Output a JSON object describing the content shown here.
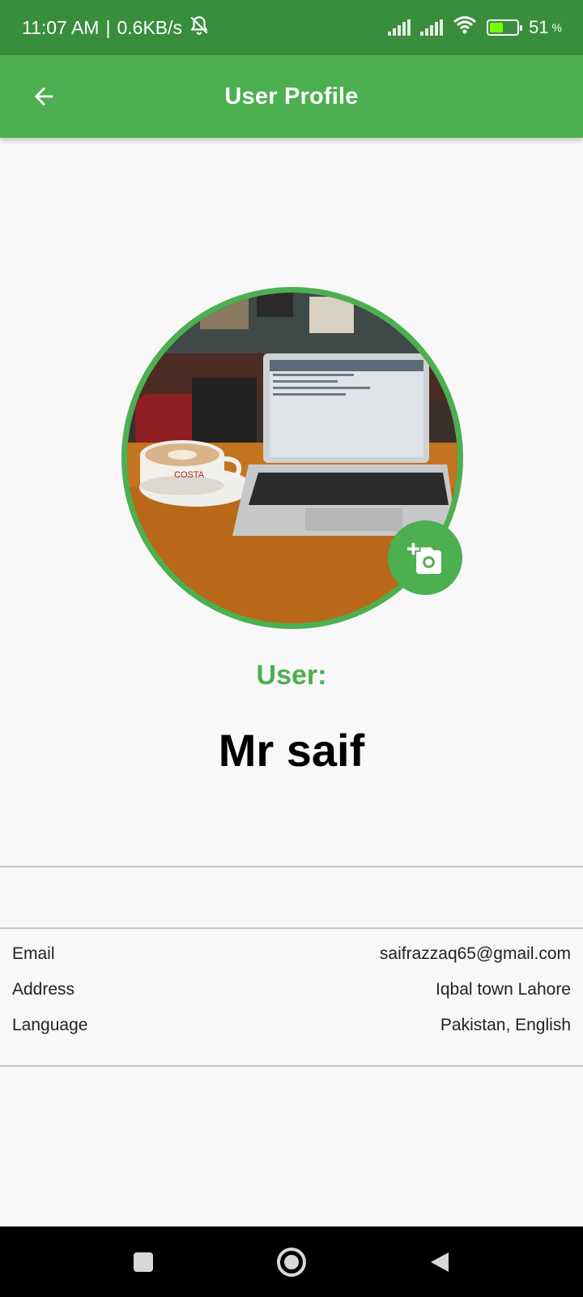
{
  "status_bar": {
    "time": "11:07 AM",
    "separator": "|",
    "speed": "0.6KB/s",
    "battery_percent": "51",
    "battery_unit": "%",
    "battery_level": 0.51,
    "icons": [
      "mute-bell-icon",
      "signal-icon",
      "signal-icon",
      "wifi-icon",
      "battery-charging-icon"
    ]
  },
  "app_bar": {
    "title": "User Profile",
    "back_icon": "arrow-back-icon"
  },
  "profile": {
    "photo_icon": "add-photo-icon",
    "label": "User:",
    "name": "Mr saif",
    "photo_text": "COSTA"
  },
  "info": [
    {
      "label": "Email",
      "value": "saifrazzaq65@gmail.com"
    },
    {
      "label": "Address",
      "value": "Iqbal town Lahore"
    },
    {
      "label": "Language",
      "value": "Pakistan, English"
    }
  ],
  "nav_bar": {
    "icons": [
      "recents-square-icon",
      "home-circle-icon",
      "back-triangle-icon"
    ]
  },
  "colors": {
    "status_bar": "#388e3c",
    "app_bar": "#4caf50",
    "accent": "#4caf50",
    "background": "#f8f8f8"
  }
}
